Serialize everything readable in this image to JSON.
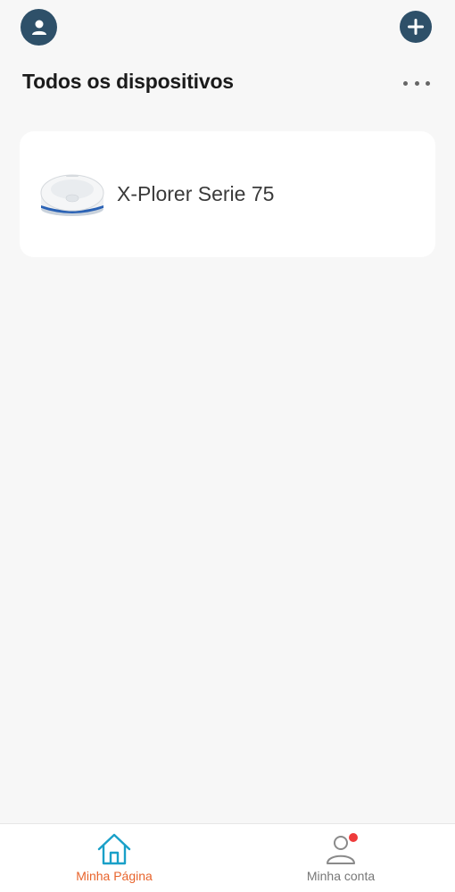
{
  "header": {
    "title": "Todos os dispositivos"
  },
  "devices": [
    {
      "name": "X-Plorer Serie 75",
      "icon": "robot-vacuum-image"
    }
  ],
  "tabbar": {
    "tabs": [
      {
        "label": "Minha Página",
        "icon": "home-icon",
        "active": true
      },
      {
        "label": "Minha conta",
        "icon": "user-icon",
        "active": false,
        "has_notification": true
      }
    ]
  },
  "colors": {
    "accent": "#2e5069",
    "active_tab": "#e8642c",
    "home_icon": "#1aa0c8",
    "notification": "#ee3b3b",
    "background": "#f7f7f7"
  }
}
